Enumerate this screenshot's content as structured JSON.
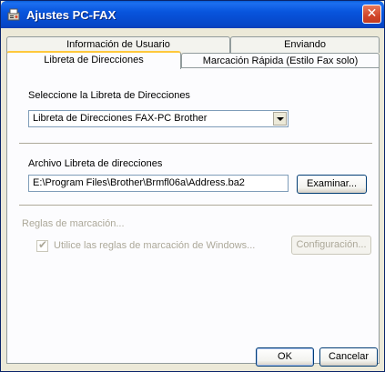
{
  "window": {
    "title": "Ajustes PC-FAX",
    "icon": "fax-app-icon",
    "close_glyph": "✕"
  },
  "tabs": {
    "row_back": [
      {
        "label": "Información de Usuario"
      },
      {
        "label": "Enviando"
      }
    ],
    "row_front": [
      {
        "label": "Libreta de Direcciones",
        "active": true
      },
      {
        "label": "Marcación Rápida (Estilo Fax solo)",
        "active": false
      }
    ]
  },
  "address_book": {
    "select_label": "Seleccione la Libreta de Direcciones",
    "select_value": "Libreta de Direcciones FAX-PC Brother"
  },
  "file": {
    "label": "Archivo Libreta de direcciones",
    "path": "E:\\Program Files\\Brother\\Brmfl06a\\Address.ba2",
    "browse_label": "Examinar..."
  },
  "dialing": {
    "group_label": "Reglas de marcación...",
    "checkbox_label": "Utilice las reglas de marcación de Windows...",
    "checked": true,
    "config_label": "Configuración..."
  },
  "footer": {
    "ok_label": "OK",
    "cancel_label": "Cancelar"
  },
  "colors": {
    "titlebar": "#0855dd",
    "dialog_bg": "#ece9d8",
    "tab_highlight": "#ffc83c",
    "disabled_text": "#aca899"
  }
}
